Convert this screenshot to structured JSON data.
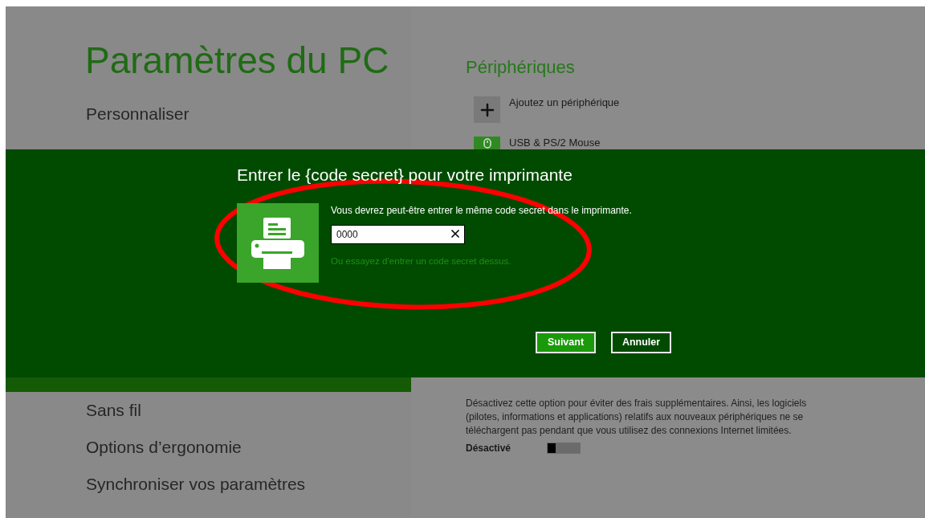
{
  "settings": {
    "title": "Paramètres du PC",
    "sidebar_items": [
      {
        "label": "Personnaliser",
        "selected": false
      },
      {
        "selected": true
      },
      {
        "label": "Sans fil",
        "selected": false
      },
      {
        "label": "Options d’ergonomie",
        "selected": false
      },
      {
        "label": "Synchroniser vos paramètres",
        "selected": false
      }
    ]
  },
  "devices": {
    "heading": "Périphériques",
    "items": [
      {
        "kind": "add",
        "label": "Ajoutez un périphérique"
      },
      {
        "kind": "mouse",
        "label": "USB & PS/2 Mouse"
      }
    ]
  },
  "metered": {
    "description": "Désactivez cette option pour éviter des frais supplémentaires. Ainsi, les logiciels (pilotes, informations et applications) relatifs aux nouveaux périphériques ne se téléchargent pas pendant que vous utilisez des connexions Internet limitées.",
    "toggle": {
      "label": "Désactivé",
      "on": false
    }
  },
  "dialog": {
    "title": "Entrer le {code secret} pour votre imprimante",
    "message": "Vous devrez peut-être entrer le même code secret dans le imprimante.",
    "pin_field": {
      "value": "0000"
    },
    "link": "Ou essayez d’entrer un code secret dessus.",
    "buttons": [
      {
        "label": "Suivant",
        "kind": "primary"
      },
      {
        "label": "Annuler",
        "kind": "secondary"
      }
    ]
  },
  "annotation": {
    "kind": "ellipse"
  }
}
